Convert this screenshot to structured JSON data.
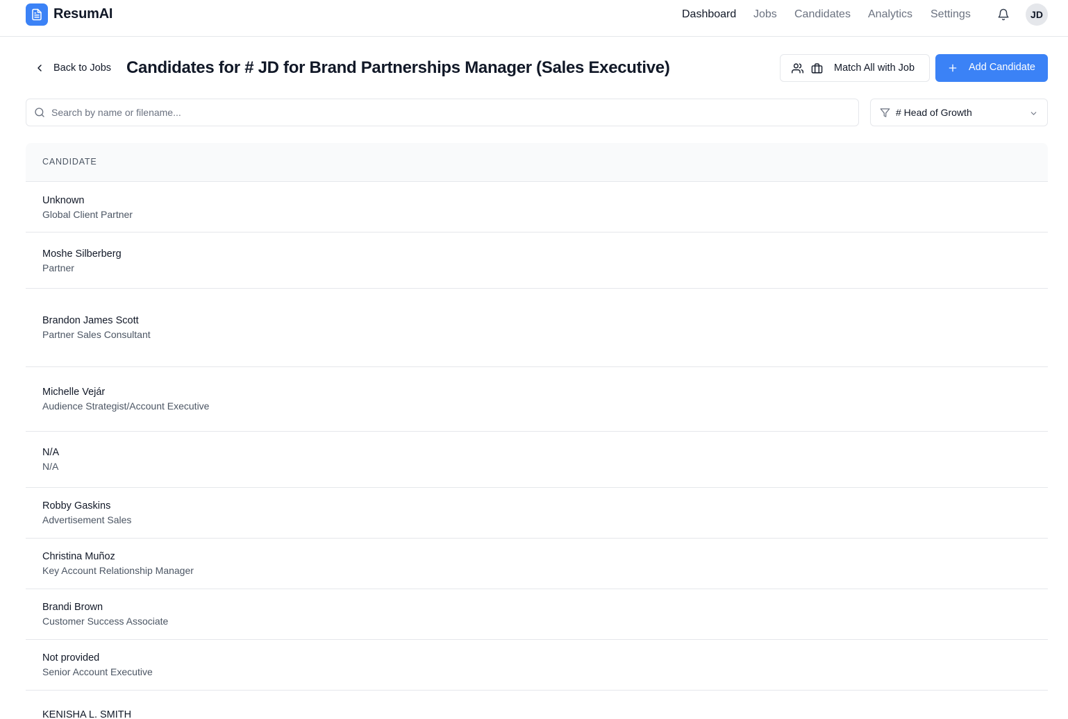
{
  "app": {
    "name": "ResumAI"
  },
  "nav": {
    "links": [
      "Dashboard",
      "Jobs",
      "Candidates",
      "Analytics",
      "Settings"
    ],
    "avatar_initials": "JD"
  },
  "header": {
    "back_label": "Back to Jobs",
    "title": "Candidates for # JD for Brand Partnerships Manager (Sales Executive)",
    "match_all_label": "Match All with Job",
    "add_candidate_label": "Add Candidate"
  },
  "search": {
    "placeholder": "Search by name or filename...",
    "value": ""
  },
  "filter": {
    "selected": "# Head of Growth"
  },
  "table": {
    "column_header": "CANDIDATE",
    "rows": [
      {
        "name": "Unknown",
        "role": "Global Client Partner"
      },
      {
        "name": "Moshe Silberberg",
        "role": "Partner"
      },
      {
        "name": "Brandon James Scott",
        "role": "Partner Sales Consultant"
      },
      {
        "name": "Michelle Vejár",
        "role": "Audience Strategist/Account Executive"
      },
      {
        "name": "N/A",
        "role": "N/A"
      },
      {
        "name": "Robby Gaskins",
        "role": "Advertisement Sales"
      },
      {
        "name": "Christina Muñoz",
        "role": "Key Account Relationship Manager"
      },
      {
        "name": "Brandi Brown",
        "role": "Customer Success Associate"
      },
      {
        "name": "Not provided",
        "role": "Senior Account Executive"
      },
      {
        "name": "KENISHA L. SMITH",
        "role": ""
      }
    ]
  },
  "colors": {
    "accent": "#3b82f6",
    "border": "#e5e7eb",
    "muted_text": "#4b5563"
  },
  "icons": [
    "document-icon",
    "bell-icon",
    "chevron-left-icon",
    "users-icon",
    "briefcase-icon",
    "plus-icon",
    "search-icon",
    "filter-icon",
    "chevron-down-icon"
  ]
}
